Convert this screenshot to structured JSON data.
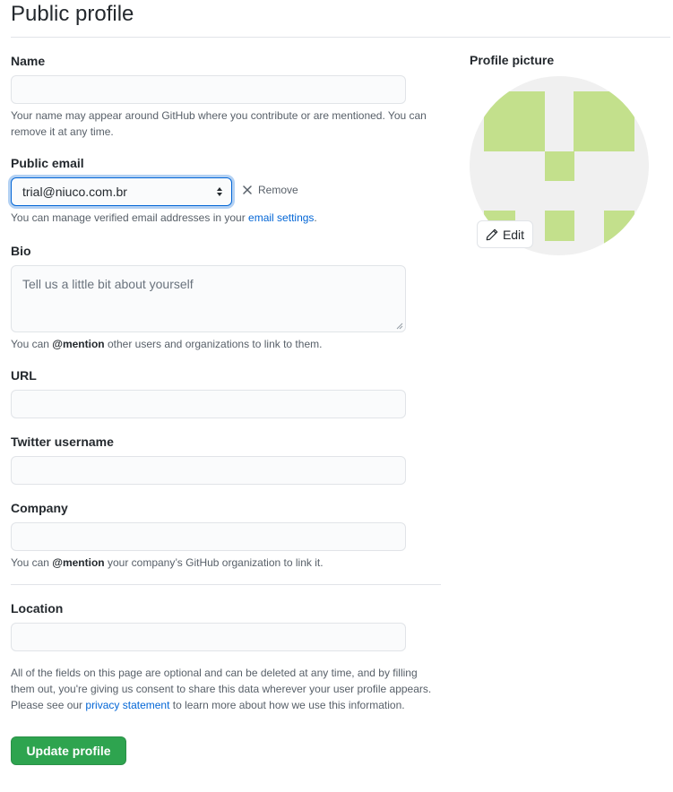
{
  "page": {
    "title": "Public profile"
  },
  "name": {
    "label": "Name",
    "value": "",
    "note": "Your name may appear around GitHub where you contribute or are mentioned. You can remove it at any time."
  },
  "public_email": {
    "label": "Public email",
    "selected": "trial@niuco.com.br",
    "remove_label": "Remove",
    "note_prefix": "You can manage verified email addresses in your ",
    "note_link": "email settings",
    "note_suffix": "."
  },
  "bio": {
    "label": "Bio",
    "placeholder": "Tell us a little bit about yourself",
    "note_prefix": "You can ",
    "note_mention": "@mention",
    "note_suffix": " other users and organizations to link to them."
  },
  "url": {
    "label": "URL",
    "value": ""
  },
  "twitter": {
    "label": "Twitter username",
    "value": ""
  },
  "company": {
    "label": "Company",
    "value": "",
    "note_prefix": "You can ",
    "note_mention": "@mention",
    "note_suffix": " your company’s GitHub organization to link it."
  },
  "location": {
    "label": "Location",
    "value": ""
  },
  "consent": {
    "prefix": "All of the fields on this page are optional and can be deleted at any time, and by filling them out, you're giving us consent to share this data wherever your user profile appears. Please see our ",
    "link": "privacy statement",
    "suffix": " to learn more about how we use this information."
  },
  "actions": {
    "update_label": "Update profile"
  },
  "profile_picture": {
    "label": "Profile picture",
    "edit_label": "Edit",
    "identicon_color": "#c3e08c",
    "background_color": "#f0f0f0"
  },
  "colors": {
    "link": "#0366d6",
    "primary_button": "#2ea44f",
    "focus_border": "#0366d6"
  }
}
